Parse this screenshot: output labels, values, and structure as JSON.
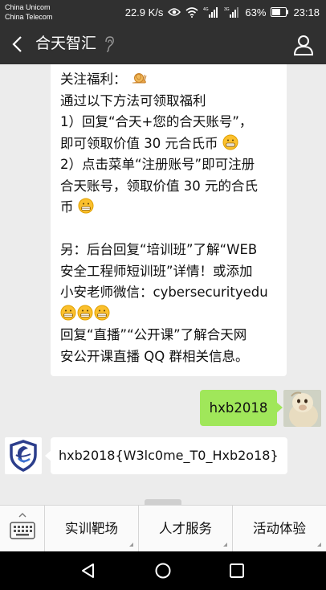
{
  "status_bar": {
    "carrier_1": "China Unicom",
    "carrier_2": "China Telecom",
    "speed": "22.9 K/s",
    "battery": "63%",
    "time": "23:18"
  },
  "header": {
    "title": "合天智汇"
  },
  "messages": {
    "welcome": {
      "l1": "关注福利：",
      "l2": "通过以下方法可领取福利",
      "l3": "1）回复“合天+您的合天账号”，",
      "l4": "即可领取价值 30 元合氏币",
      "l5": "2）点击菜单“注册账号”即可注册",
      "l6": "合天账号，领取价值 30 元的合氏",
      "l7": "币",
      "l8": "另：后台回复“培训班”了解“WEB",
      "l9": "安全工程师短训班”详情！或添加",
      "l10": "小安老师微信：cybersecurityedu",
      "l11": "回复“直播”“公开课”了解合天网",
      "l12": "安公开课直播 QQ 群相关信息。"
    },
    "sent": "hxb2018",
    "reply": "hxb2018{W3lc0me_T0_Hxb2o18}"
  },
  "menu": {
    "items": [
      "实训靶场",
      "人才服务",
      "活动体验"
    ]
  },
  "colors": {
    "bar_dark": "#303030",
    "chat_bg": "#ececec",
    "sent_bubble": "#a0e75a",
    "shield_navy": "#2c3e8c"
  }
}
